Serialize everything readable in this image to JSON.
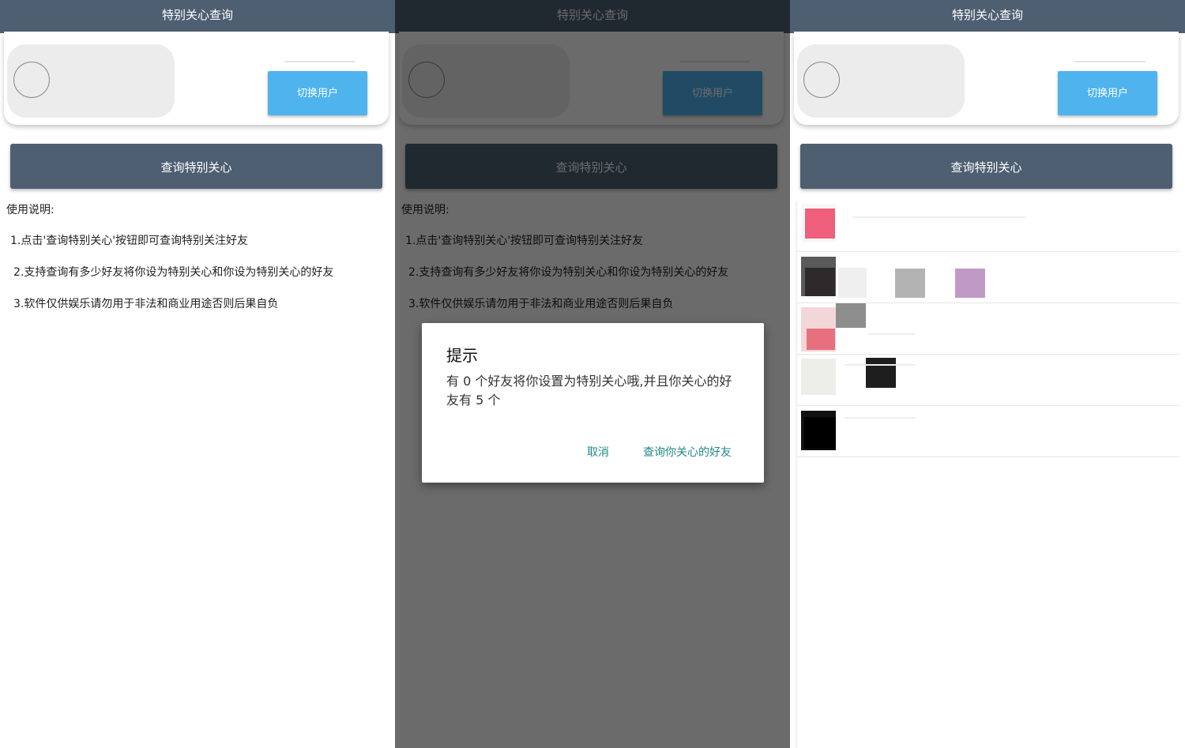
{
  "app_title": "特别关心查询",
  "switch_user_label": "切换用户",
  "query_button_label": "查询特别关心",
  "usage": {
    "title": "使用说明:",
    "items": [
      "1.点击'查询特别关心'按钮即可查询特别关注好友",
      "2.支持查询有多少好友将你设为特别关心和你设为特别关心的好友",
      "3.软件仅供娱乐请勿用于非法和商业用途否则后果自负"
    ]
  },
  "dialog": {
    "title": "提示",
    "message": "有 0 个好友将你设置为特别关心哦,并且你关心的好友有 5 个",
    "cancel_label": "取消",
    "confirm_label": "查询你关心的好友"
  },
  "colors": {
    "appbar": "#4e5f72",
    "switch_button": "#4fb3ee",
    "dialog_action": "#1f8a85",
    "scrim": "rgba(0,0,0,0.58)"
  },
  "friend_list_count": 5
}
